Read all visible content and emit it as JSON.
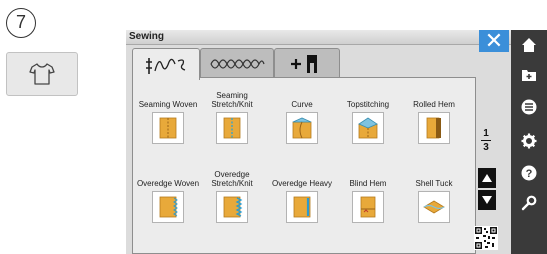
{
  "step": {
    "number": "7"
  },
  "window": {
    "title": "Sewing",
    "close_icon": "close-icon"
  },
  "tabs": [
    {
      "icon": "stitch-tab-icon",
      "active": true
    },
    {
      "icon": "decorative-stitch-tab-icon",
      "active": false
    },
    {
      "icon": "add-pattern-tab-icon",
      "active": false
    }
  ],
  "stitches": [
    {
      "label": "Seaming Woven",
      "icon": "fabric-panel-icon"
    },
    {
      "label": "Seaming Stretch/Knit",
      "icon": "fabric-panel-icon"
    },
    {
      "label": "Curve",
      "icon": "fabric-fold-icon"
    },
    {
      "label": "Topstitching",
      "icon": "fabric-fold-icon"
    },
    {
      "label": "Rolled Hem",
      "icon": "fabric-panel-icon"
    },
    {
      "label": "Overedge Woven",
      "icon": "fabric-panel-icon"
    },
    {
      "label": "Overedge Stretch/Knit",
      "icon": "fabric-panel-icon"
    },
    {
      "label": "Overedge Heavy",
      "icon": "fabric-panel-icon"
    },
    {
      "label": "Blind Hem",
      "icon": "fabric-panel-icon"
    },
    {
      "label": "Shell Tuck",
      "icon": "fabric-fold-icon"
    }
  ],
  "pager": {
    "current": "1",
    "total": "3"
  },
  "sidebar": [
    "home-icon",
    "folder-icon",
    "menu-icon",
    "settings-icon",
    "help-icon",
    "wrench-icon"
  ],
  "colors": {
    "accent": "#3b8fd9",
    "sidebar": "#3a3a3a",
    "fabric": "#e8a93a"
  }
}
